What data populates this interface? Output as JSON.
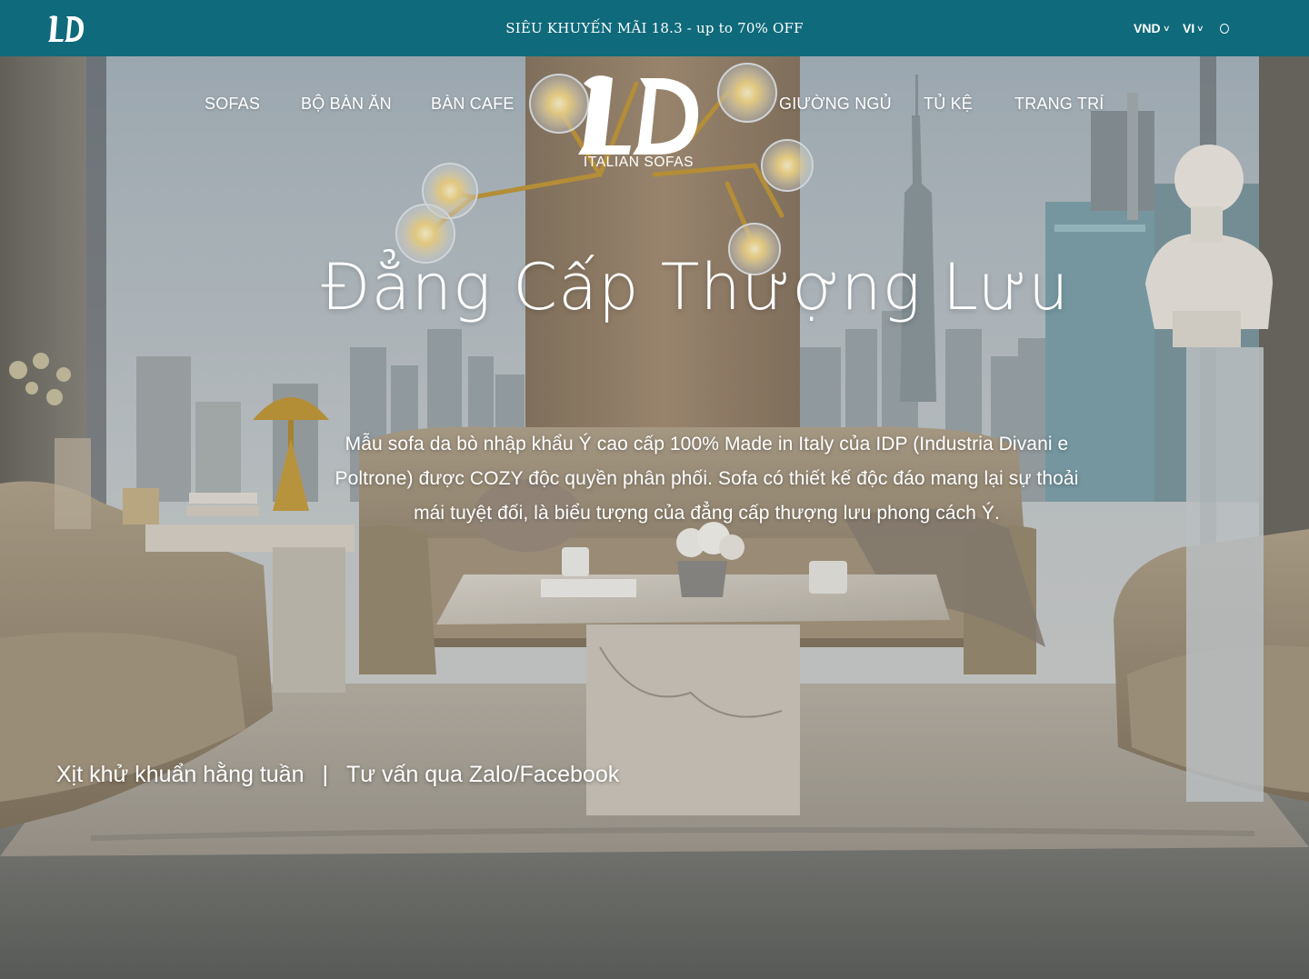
{
  "topbar": {
    "promo": "SIÊU KHUYẾN MÃI 18.3 - up to 70% OFF",
    "currency": "VND",
    "language": "VI",
    "background": "#0f6a7b"
  },
  "nav": {
    "left": [
      "SOFAS",
      "BỘ BÀN ĂN",
      "BÀN CAFE"
    ],
    "right": [
      "GIƯỜNG NGỦ",
      "TỦ KỆ",
      "TRANG TRÍ"
    ],
    "logo_text": "LD",
    "logo_tagline": "ITALIAN SOFAS"
  },
  "hero": {
    "title": "Đẳng Cấp Thượng Lưu",
    "description": "Mẫu sofa da bò nhập khẩu Ý cao cấp 100% Made in Italy của IDP (Industria Divani e Poltrone) được COZY độc quyền phân phối. Sofa có thiết kế độc đáo mang lại sự thoải mái tuyệt đối, là biểu tượng của đẳng cấp thượng lưu phong cách Ý."
  },
  "services": {
    "link1": "Xịt khử khuẩn hằng tuần",
    "separator": "|",
    "link2": "Tư vấn qua Zalo/Facebook"
  }
}
